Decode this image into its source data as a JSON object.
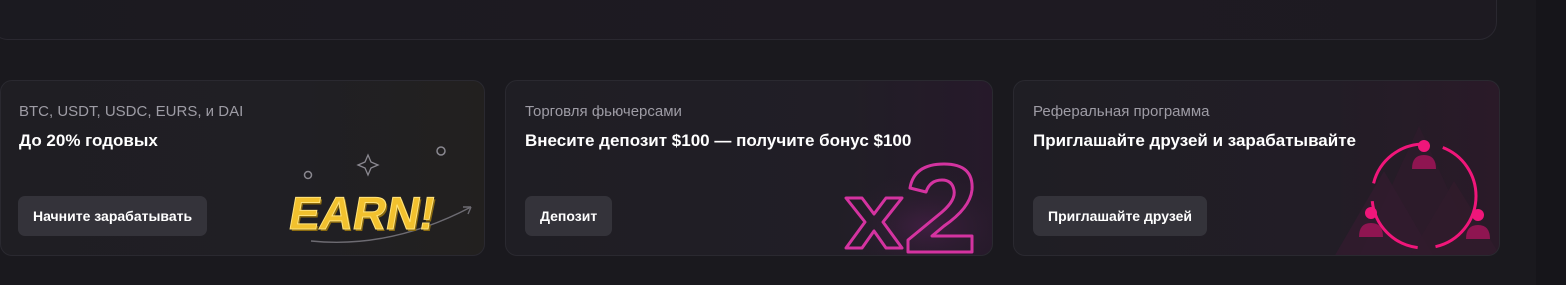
{
  "promo_cards": [
    {
      "subtitle": "BTC, USDT, USDC, EURS, и DAI",
      "title": "До 20% годовых",
      "button_label": "Начните зарабатывать",
      "illustration_text": "EARN!",
      "illustration_icon": "earn-badge-icon"
    },
    {
      "subtitle": "Торговля фьючерсами",
      "title": "Внесите депозит $100 — получите бонус $100",
      "button_label": "Депозит",
      "illustration_text": "x2",
      "illustration_icon": "x2-neon-icon"
    },
    {
      "subtitle": "Реферальная программа",
      "title": "Приглашайте друзей и зарабатывайте",
      "button_label": "Приглашайте друзей",
      "illustration_icon": "referral-network-icon"
    }
  ],
  "colors": {
    "background": "#1a191e",
    "card": "#1f1e24",
    "button": "#34333a",
    "earn_yellow": "#f2c12e",
    "neon_pink": "#e0399e",
    "referral_pink": "#f0167a"
  }
}
